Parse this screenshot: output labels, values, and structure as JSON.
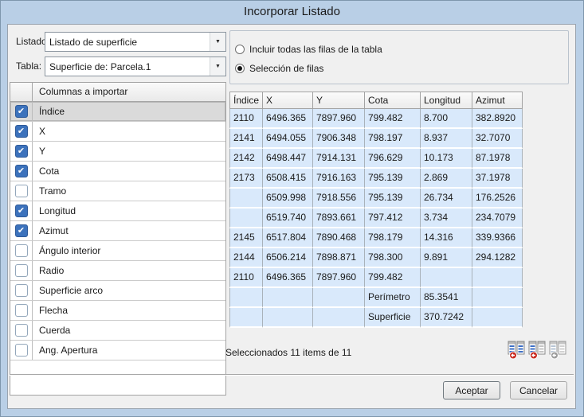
{
  "window": {
    "title": "Incorporar Listado"
  },
  "fields": {
    "listado": {
      "label": "Listado:",
      "value": "Listado de superficie"
    },
    "tabla": {
      "label": "Tabla:",
      "value": "Superficie de: Parcela.1"
    }
  },
  "columns_list": {
    "header": "Columnas a importar",
    "items": [
      {
        "label": "Índice",
        "checked": true,
        "selected": true
      },
      {
        "label": "X",
        "checked": true,
        "selected": false
      },
      {
        "label": "Y",
        "checked": true,
        "selected": false
      },
      {
        "label": "Cota",
        "checked": true,
        "selected": false
      },
      {
        "label": "Tramo",
        "checked": false,
        "selected": false
      },
      {
        "label": "Longitud",
        "checked": true,
        "selected": false
      },
      {
        "label": "Azimut",
        "checked": true,
        "selected": false
      },
      {
        "label": "Ángulo interior",
        "checked": false,
        "selected": false
      },
      {
        "label": "Radio",
        "checked": false,
        "selected": false
      },
      {
        "label": "Superficie arco",
        "checked": false,
        "selected": false
      },
      {
        "label": "Flecha",
        "checked": false,
        "selected": false
      },
      {
        "label": "Cuerda",
        "checked": false,
        "selected": false
      },
      {
        "label": "Ang. Apertura",
        "checked": false,
        "selected": false
      }
    ]
  },
  "row_options": {
    "all_rows": {
      "label": "Incluir todas las filas de la tabla",
      "selected": false
    },
    "row_selection": {
      "label": "Selección de filas",
      "selected": true
    }
  },
  "table": {
    "headers": [
      "Índice",
      "X",
      "Y",
      "Cota",
      "Longitud",
      "Azimut"
    ],
    "rows": [
      [
        "2110",
        "6496.365",
        "7897.960",
        "799.482",
        "8.700",
        "382.8920"
      ],
      [
        "2141",
        "6494.055",
        "7906.348",
        "798.197",
        "8.937",
        "32.7070"
      ],
      [
        "2142",
        "6498.447",
        "7914.131",
        "796.629",
        "10.173",
        "87.1978"
      ],
      [
        "2173",
        "6508.415",
        "7916.163",
        "795.139",
        "2.869",
        "37.1978"
      ],
      [
        "",
        "6509.998",
        "7918.556",
        "795.139",
        "26.734",
        "176.2526"
      ],
      [
        "",
        "6519.740",
        "7893.661",
        "797.412",
        "3.734",
        "234.7079"
      ],
      [
        "2145",
        "6517.804",
        "7890.468",
        "798.179",
        "14.316",
        "339.9366"
      ],
      [
        "2144",
        "6506.214",
        "7898.871",
        "798.300",
        "9.891",
        "294.1282"
      ],
      [
        "2110",
        "6496.365",
        "7897.960",
        "799.482",
        "",
        ""
      ],
      [
        "",
        "",
        "",
        "Perímetro",
        "85.3541",
        ""
      ],
      [
        "",
        "",
        "",
        "Superficie",
        "370.7242",
        ""
      ]
    ]
  },
  "status_text": "Seleccionados 11 items de 11",
  "icons": {
    "combo_arrow": "▼",
    "check_glyph": "✔",
    "toolbar": [
      "select-all-items-icon",
      "select-current-item-icon",
      "clear-selection-icon"
    ]
  },
  "buttons": {
    "accept": "Aceptar",
    "cancel": "Cancelar"
  },
  "colors": {
    "title_bg": "#b9cfe6",
    "accent_blue": "#3c72bc",
    "row_blue": "#d9e9fb",
    "badge_red": "#c8281e",
    "badge_grey": "#9c9c9c"
  }
}
